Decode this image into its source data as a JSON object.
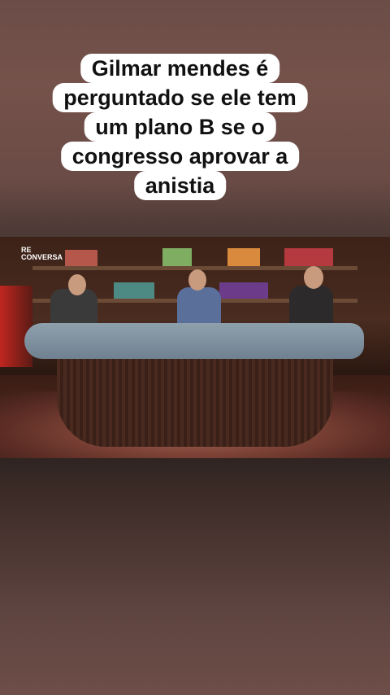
{
  "caption": {
    "lines": [
      "Gilmar mendes é",
      "perguntado se ele tem",
      "um plano B se o",
      "congresso aprovar a",
      "anistia"
    ]
  },
  "logo": {
    "line1": "RE",
    "line2": "CONVERSA"
  }
}
